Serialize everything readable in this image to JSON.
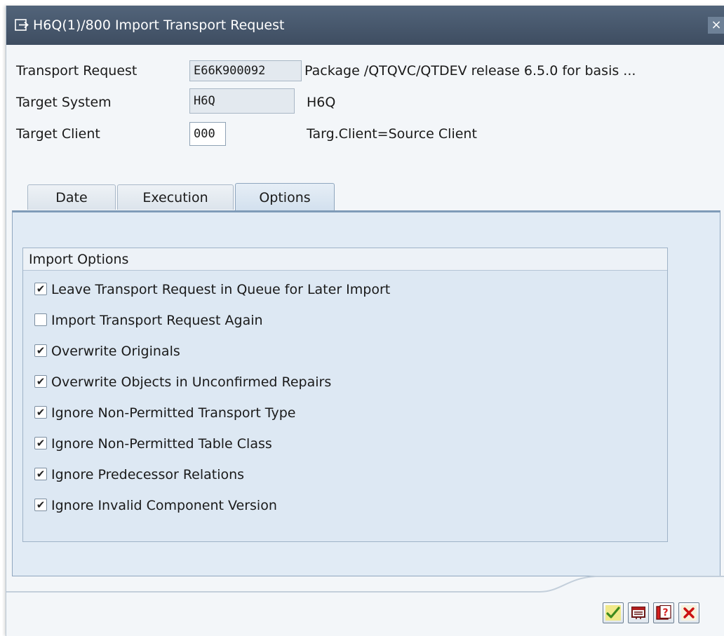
{
  "window": {
    "title": "H6Q(1)/800 Import Transport Request",
    "close_label": "×"
  },
  "fields": {
    "transport_request": {
      "label": "Transport Request",
      "value": "E66K900092",
      "description": "Package /QTQVC/QTDEV release 6.5.0 for basis ..."
    },
    "target_system": {
      "label": "Target System",
      "value": "H6Q",
      "description": "H6Q"
    },
    "target_client": {
      "label": "Target Client",
      "value": "000",
      "description": "Targ.Client=Source Client"
    }
  },
  "tabs": [
    {
      "label": "Date"
    },
    {
      "label": "Execution"
    },
    {
      "label": "Options",
      "active": true
    }
  ],
  "import_options": {
    "title": "Import Options",
    "items": [
      {
        "label": "Leave Transport Request in Queue for Later Import",
        "checked": true
      },
      {
        "label": "Import Transport Request Again",
        "checked": false
      },
      {
        "label": "Overwrite Originals",
        "checked": true
      },
      {
        "label": "Overwrite Objects in Unconfirmed Repairs",
        "checked": true
      },
      {
        "label": "Ignore Non-Permitted Transport Type",
        "checked": true
      },
      {
        "label": "Ignore Non-Permitted Table Class",
        "checked": true
      },
      {
        "label": "Ignore Predecessor Relations",
        "checked": true
      },
      {
        "label": "Ignore Invalid Component Version",
        "checked": true
      }
    ]
  },
  "footer_buttons": [
    "confirm-icon",
    "details-icon",
    "help-icon",
    "cancel-icon"
  ],
  "colors": {
    "titlebar": "#4a5b70",
    "panel": "#e1ebf5",
    "confirm": "#3d8a1e",
    "cancel": "#cc1111"
  }
}
